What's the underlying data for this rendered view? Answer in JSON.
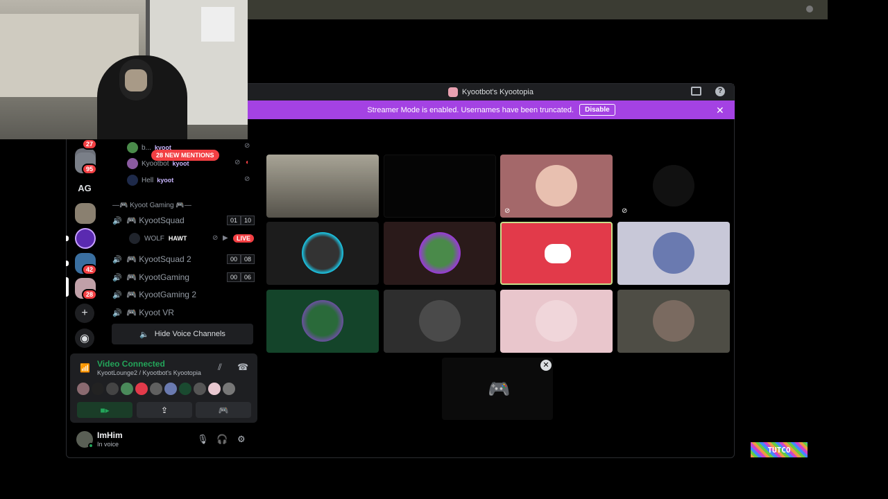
{
  "window": {
    "title": "Kyootbot's Kyootopia"
  },
  "streamer_bar": {
    "message": "Streamer Mode is enabled. Usernames have been truncated.",
    "disable_label": "Disable"
  },
  "servers": [
    {
      "badge": "27"
    },
    {
      "badge": "95"
    },
    {
      "label": "AG"
    },
    {
      "badge": ""
    },
    {
      "badge": ""
    },
    {
      "badge": "42"
    },
    {
      "badge": "28"
    }
  ],
  "mentions": {
    "label": "28 NEW MENTIONS"
  },
  "channel_users": [
    {
      "name": "b...",
      "tag": "kyoot"
    },
    {
      "name": "Kyootbot",
      "tag": "kyoot"
    },
    {
      "name": "Hell",
      "tag": "kyoot"
    }
  ],
  "category": {
    "label": "—🎮 Kyoot Gaming 🎮—"
  },
  "voice_channels": [
    {
      "name": "🎮 KyootSquad",
      "counter": [
        "01",
        "10"
      ]
    },
    {
      "name": "🎮 KyootSquad 2",
      "counter": [
        "00",
        "08"
      ]
    },
    {
      "name": "🎮 KyootGaming",
      "counter": [
        "00",
        "06"
      ]
    },
    {
      "name": "🎮 KyootGaming 2",
      "counter": []
    },
    {
      "name": "🎮 Kyoot VR",
      "counter": []
    }
  ],
  "wolf_user": {
    "name": "WOLF",
    "tag": "HAWT",
    "live": "LIVE"
  },
  "hide_voice": {
    "label": "Hide Voice Channels"
  },
  "voice_panel": {
    "title": "Video Connected",
    "subtitle": "KyootLounge2 / Kyootbot's Kyootopia"
  },
  "user": {
    "name": "ImHim",
    "status": "In voice"
  },
  "watermark": {
    "text": "TUTCO"
  },
  "colors": {
    "accent": "#a442e3",
    "discord_red": "#e23a4a",
    "connected_green": "#23a55a"
  }
}
